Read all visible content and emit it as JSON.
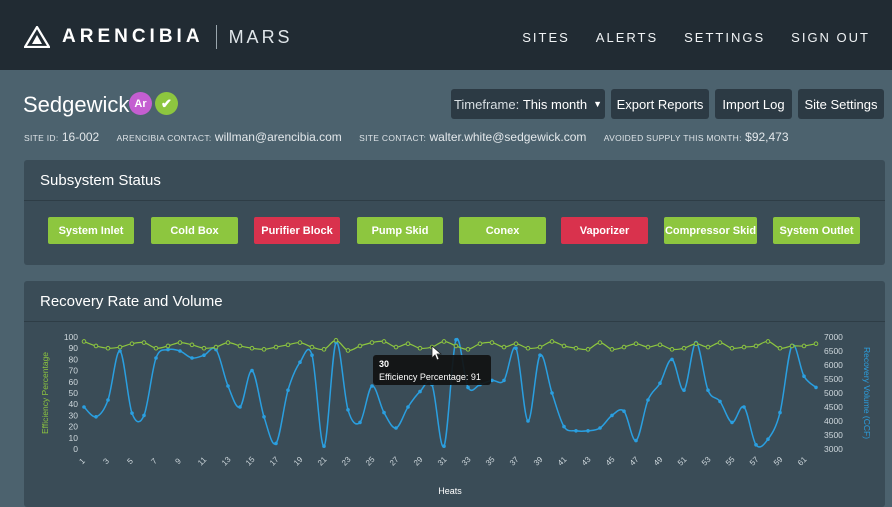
{
  "header": {
    "brand": "ARENCIBIA",
    "product": "MARS",
    "nav": [
      "SITES",
      "ALERTS",
      "SETTINGS",
      "SIGN OUT"
    ]
  },
  "site": {
    "name": "Sedgewick",
    "badge_initials": "Ar",
    "badge_check": "✔",
    "timeframe_label": "Timeframe:",
    "timeframe_value": "This month",
    "export_label": "Export Reports",
    "import_label": "Import Log",
    "settings_label": "Site Settings",
    "meta": {
      "site_id_key": "SITE ID:",
      "site_id": "16-002",
      "contact_key": "ARENCIBIA CONTACT:",
      "contact": "willman@arencibia.com",
      "site_contact_key": "SITE CONTACT:",
      "site_contact": "walter.white@sedgewick.com",
      "avoided_key": "AVOIDED SUPPLY THIS MONTH:",
      "avoided": "$92,473"
    }
  },
  "subsystem": {
    "title": "Subsystem Status",
    "items": [
      {
        "label": "System Inlet",
        "status": "ok"
      },
      {
        "label": "Cold Box",
        "status": "ok"
      },
      {
        "label": "Purifier Block",
        "status": "alert"
      },
      {
        "label": "Pump Skid",
        "status": "ok"
      },
      {
        "label": "Conex",
        "status": "ok"
      },
      {
        "label": "Vaporizer",
        "status": "alert"
      },
      {
        "label": "Compressor Skid",
        "status": "ok"
      },
      {
        "label": "System Outlet",
        "status": "ok"
      }
    ]
  },
  "recovery": {
    "title": "Recovery Rate and Volume"
  },
  "colors": {
    "ok": "#8dc63f",
    "alert": "#d9324d",
    "efficiency": "#8dc63f",
    "volume": "#2a9fe0"
  },
  "chart_data": {
    "type": "line",
    "xlabel": "Heats",
    "ylabel_left": "Efficiency Percentage",
    "ylabel_right": "Recovery Volume (CCF)",
    "x": [
      1,
      2,
      3,
      4,
      5,
      6,
      7,
      8,
      9,
      10,
      11,
      12,
      13,
      14,
      15,
      16,
      17,
      18,
      19,
      20,
      21,
      22,
      23,
      24,
      25,
      26,
      27,
      28,
      29,
      30,
      31,
      32,
      33,
      34,
      35,
      36,
      37,
      38,
      39,
      40,
      41,
      42,
      43,
      44,
      45,
      46,
      47,
      48,
      49,
      50,
      51,
      52,
      53,
      54,
      55,
      56,
      57,
      58,
      59,
      60,
      61,
      62
    ],
    "x_ticks": [
      1,
      3,
      5,
      7,
      9,
      11,
      13,
      15,
      17,
      19,
      21,
      23,
      25,
      27,
      29,
      31,
      33,
      35,
      37,
      39,
      41,
      43,
      45,
      47,
      49,
      51,
      53,
      55,
      57,
      59,
      61
    ],
    "ylim_left": [
      0,
      100
    ],
    "yticks_left": [
      0,
      10,
      20,
      30,
      40,
      50,
      60,
      70,
      80,
      90,
      100
    ],
    "ylim_right": [
      3000,
      7000
    ],
    "yticks_right": [
      3000,
      3500,
      4000,
      4500,
      5000,
      5500,
      6000,
      6500,
      7000
    ],
    "series": [
      {
        "name": "Efficiency Percentage",
        "axis": "left",
        "values": [
          96,
          92,
          90,
          91,
          94,
          95,
          90,
          92,
          95,
          93,
          90,
          91,
          95,
          92,
          90,
          89,
          91,
          93,
          95,
          91,
          89,
          97,
          88,
          92,
          95,
          96,
          91,
          94,
          90,
          91,
          96,
          92,
          89,
          94,
          95,
          91,
          94,
          90,
          91,
          96,
          92,
          90,
          89,
          95,
          89,
          91,
          94,
          91,
          93,
          89,
          90,
          94,
          91,
          95,
          90,
          91,
          92,
          96,
          90,
          92,
          92,
          94
        ]
      },
      {
        "name": "Recovery Volume (CCF)",
        "axis": "right",
        "values": [
          4500,
          4150,
          4750,
          6500,
          4280,
          4200,
          6250,
          6550,
          6500,
          6250,
          6350,
          6550,
          5250,
          4500,
          5800,
          4150,
          3200,
          5100,
          6100,
          6350,
          3100,
          6800,
          4400,
          3950,
          5250,
          4300,
          3750,
          4500,
          5050,
          5300,
          3100,
          6900,
          5200,
          5300,
          5450,
          5450,
          6600,
          4000,
          6350,
          5000,
          3800,
          3650,
          3650,
          3750,
          4200,
          4350,
          3300,
          4750,
          5350,
          6200,
          5100,
          6800,
          5100,
          4700,
          3950,
          4500,
          3150,
          3350,
          4300,
          6700,
          5600,
          5200
        ]
      }
    ],
    "tooltip": {
      "heat": "30",
      "label": "Efficiency Percentage:",
      "value": "91"
    }
  }
}
